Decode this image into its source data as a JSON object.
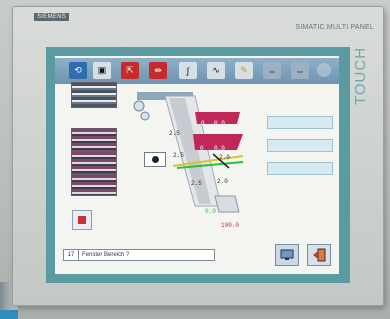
{
  "device": {
    "brand": "SIEMENS",
    "model": "SIMATIC MULTI PANEL",
    "touch_label": "TOUCH"
  },
  "toolbar": {
    "buttons": [
      {
        "name": "cycle-icon",
        "glyph": "⟲"
      },
      {
        "name": "panel-icon",
        "glyph": "▣"
      },
      {
        "name": "expand-icon",
        "glyph": "⇱"
      },
      {
        "name": "spread-icon",
        "glyph": "⇹"
      },
      {
        "name": "curve-icon",
        "glyph": "∫"
      },
      {
        "name": "wave-icon",
        "glyph": "∿"
      },
      {
        "name": "wrench-icon",
        "glyph": "✎"
      },
      {
        "name": "align-icon",
        "glyph": "⇔"
      },
      {
        "name": "align-alt-icon",
        "glyph": "⇔"
      }
    ]
  },
  "machine": {
    "upper_left": "0",
    "upper_right": "0.0",
    "mid_left": "0",
    "mid_right": "0.0",
    "tag_a": "2.5",
    "tag_b": "2.5",
    "tag_c": "2.5",
    "tag_d": "2.0",
    "small_left": "2.5",
    "small_right": "2.0",
    "green_value": "0.0",
    "red_value": "100.0"
  },
  "status_bar": {
    "number": "17",
    "message": "Fenster Bereich ?"
  },
  "colors": {
    "frame": "#5a9aa0",
    "toolbar": "#6e94b0",
    "machine_red": "#c0285a",
    "accent_green": "#2cbf3a"
  }
}
